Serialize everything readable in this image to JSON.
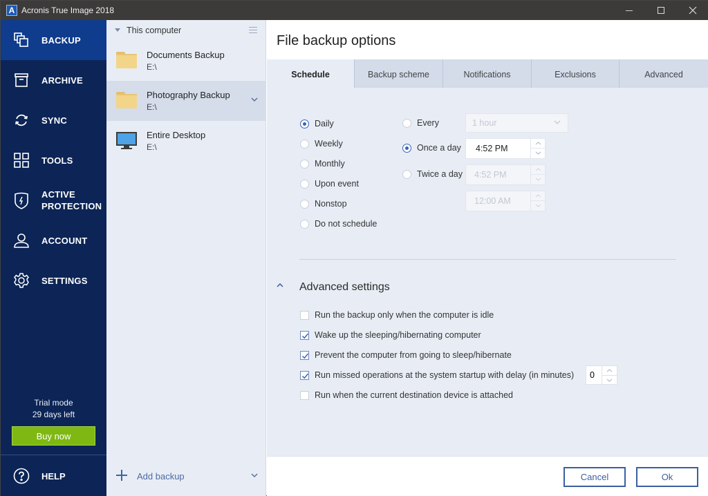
{
  "window": {
    "title": "Acronis True Image 2018",
    "app_icon_letter": "A",
    "controls": [
      "minimize",
      "maximize",
      "close"
    ]
  },
  "sidebar": {
    "items": [
      {
        "label": "BACKUP",
        "icon": "backup-icon",
        "active": true
      },
      {
        "label": "ARCHIVE",
        "icon": "archive-icon",
        "active": false
      },
      {
        "label": "SYNC",
        "icon": "sync-icon",
        "active": false
      },
      {
        "label": "TOOLS",
        "icon": "tools-icon",
        "active": false
      },
      {
        "label": "ACTIVE PROTECTION",
        "label_line1": "ACTIVE",
        "label_line2": "PROTECTION",
        "icon": "shield-icon",
        "active": false
      },
      {
        "label": "ACCOUNT",
        "icon": "user-icon",
        "active": false
      },
      {
        "label": "SETTINGS",
        "icon": "gear-icon",
        "active": false
      }
    ],
    "trial_line1": "Trial mode",
    "trial_line2": "29 days left",
    "buy_label": "Buy now",
    "help_label": "HELP"
  },
  "backup_list": {
    "header": "This computer",
    "items": [
      {
        "name": "Documents Backup",
        "path": "E:\\",
        "icon": "folder-icon",
        "selected": false
      },
      {
        "name": "Photography Backup",
        "path": "E:\\",
        "icon": "folder-icon",
        "selected": true
      },
      {
        "name": "Entire Desktop",
        "path": "E:\\",
        "icon": "monitor-icon",
        "selected": false
      }
    ],
    "add_label": "Add backup"
  },
  "main": {
    "title": "File backup options",
    "tabs": [
      {
        "label": "Schedule",
        "active": true
      },
      {
        "label": "Backup scheme",
        "active": false
      },
      {
        "label": "Notifications",
        "active": false
      },
      {
        "label": "Exclusions",
        "active": false
      },
      {
        "label": "Advanced",
        "active": false
      }
    ],
    "schedule_types": [
      {
        "label": "Daily",
        "selected": true
      },
      {
        "label": "Weekly",
        "selected": false
      },
      {
        "label": "Monthly",
        "selected": false
      },
      {
        "label": "Upon event",
        "selected": false
      },
      {
        "label": "Nonstop",
        "selected": false
      },
      {
        "label": "Do not schedule",
        "selected": false
      }
    ],
    "frequency": {
      "every_label": "Every",
      "every_value": "1 hour",
      "once_label": "Once a day",
      "once_value": "4:52 PM",
      "twice_label": "Twice a day",
      "twice_value1": "4:52 PM",
      "twice_value2": "12:00 AM",
      "selected": "once"
    },
    "advanced": {
      "title": "Advanced settings",
      "options": [
        {
          "label": "Run the backup only when the computer is idle",
          "checked": false
        },
        {
          "label": "Wake up the sleeping/hibernating computer",
          "checked": true
        },
        {
          "label": "Prevent the computer from going to sleep/hibernate",
          "checked": true
        },
        {
          "label": "Run missed operations at the system startup with delay (in minutes)",
          "checked": true
        },
        {
          "label": "Run when the current destination device is attached",
          "checked": false
        }
      ],
      "delay_value": "0"
    },
    "cancel_label": "Cancel",
    "ok_label": "Ok"
  },
  "colors": {
    "sidebar_bg": "#0c2556",
    "sidebar_active": "#0f3c8c",
    "accent": "#3a62b5",
    "buy_button": "#7fb813"
  }
}
